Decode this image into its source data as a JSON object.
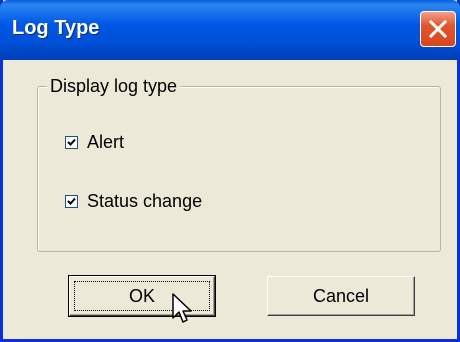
{
  "window": {
    "title": "Log Type",
    "close_icon": "close-icon"
  },
  "group": {
    "label": "Display log type"
  },
  "checkboxes": [
    {
      "label": "Alert",
      "checked": true
    },
    {
      "label": "Status change",
      "checked": true
    }
  ],
  "buttons": {
    "ok_label": "OK",
    "cancel_label": "Cancel"
  },
  "colors": {
    "titlebar": "#0058e6",
    "dialog_bg": "#ece9d8",
    "close_button": "#e2552f"
  }
}
